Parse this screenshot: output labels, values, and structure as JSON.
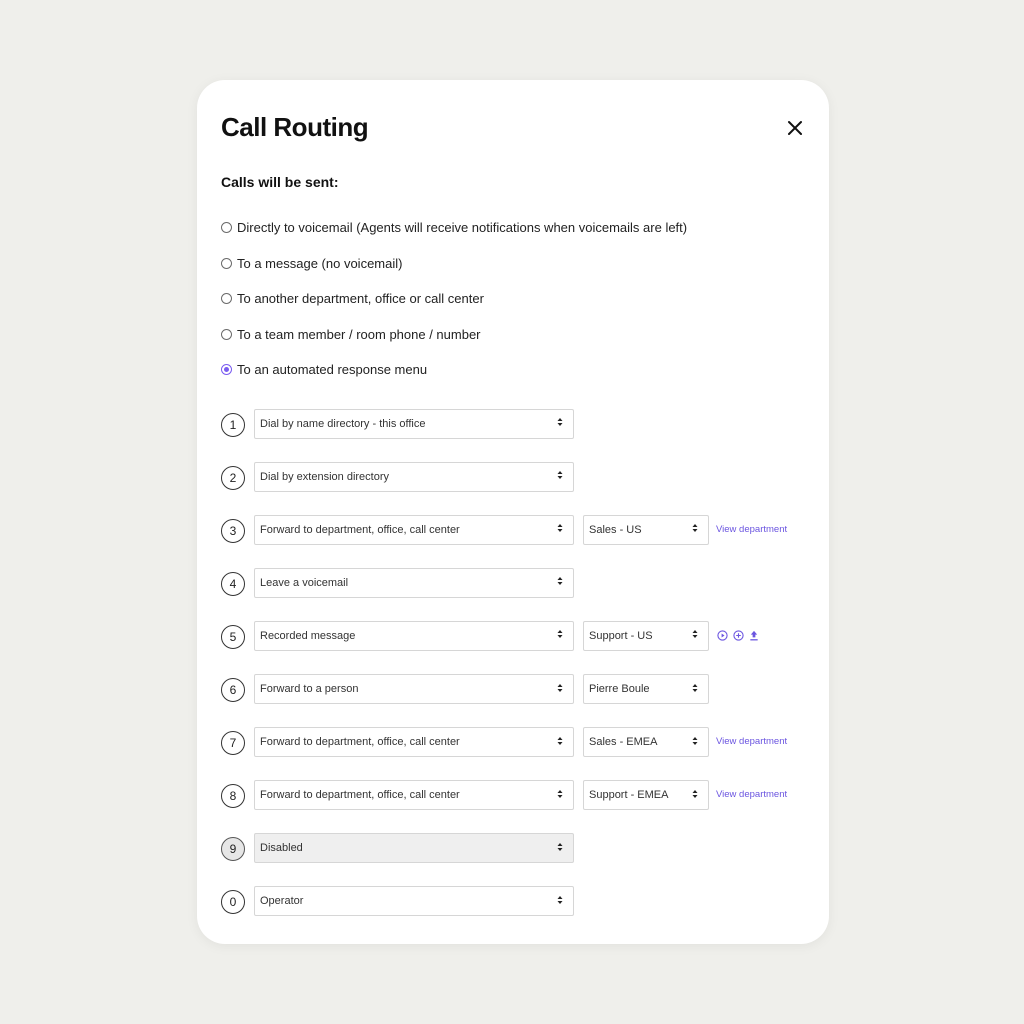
{
  "dialog": {
    "title": "Call Routing",
    "subtitle": "Calls will be sent:",
    "close_icon": "close-icon",
    "accent_color": "#7a5cf0"
  },
  "routing_options": [
    {
      "label": "Directly to voicemail (Agents will receive notifications when voicemails are left)",
      "checked": false
    },
    {
      "label": "To a message (no voicemail)",
      "checked": false
    },
    {
      "label": "To another department, office or call center",
      "checked": false
    },
    {
      "label": "To a team member / room phone / number",
      "checked": false
    },
    {
      "label": "To an automated response menu",
      "checked": true
    }
  ],
  "menu": [
    {
      "key": "1",
      "action": "Dial by name directory - this office"
    },
    {
      "key": "2",
      "action": "Dial by extension directory"
    },
    {
      "key": "3",
      "action": "Forward to department, office, call center",
      "target": "Sales - US",
      "link": "View department"
    },
    {
      "key": "4",
      "action": "Leave a voicemail"
    },
    {
      "key": "5",
      "action": "Recorded message",
      "target": "Support - US",
      "icons": [
        "play-icon",
        "add-icon",
        "upload-icon"
      ]
    },
    {
      "key": "6",
      "action": "Forward to a person",
      "target": "Pierre Boule"
    },
    {
      "key": "7",
      "action": "Forward to department, office, call center",
      "target": "Sales - EMEA",
      "link": "View department"
    },
    {
      "key": "8",
      "action": "Forward to department, office, call center",
      "target": "Support - EMEA",
      "link": "View department"
    },
    {
      "key": "9",
      "action": "Disabled",
      "disabled": true
    },
    {
      "key": "0",
      "action": "Operator"
    }
  ]
}
